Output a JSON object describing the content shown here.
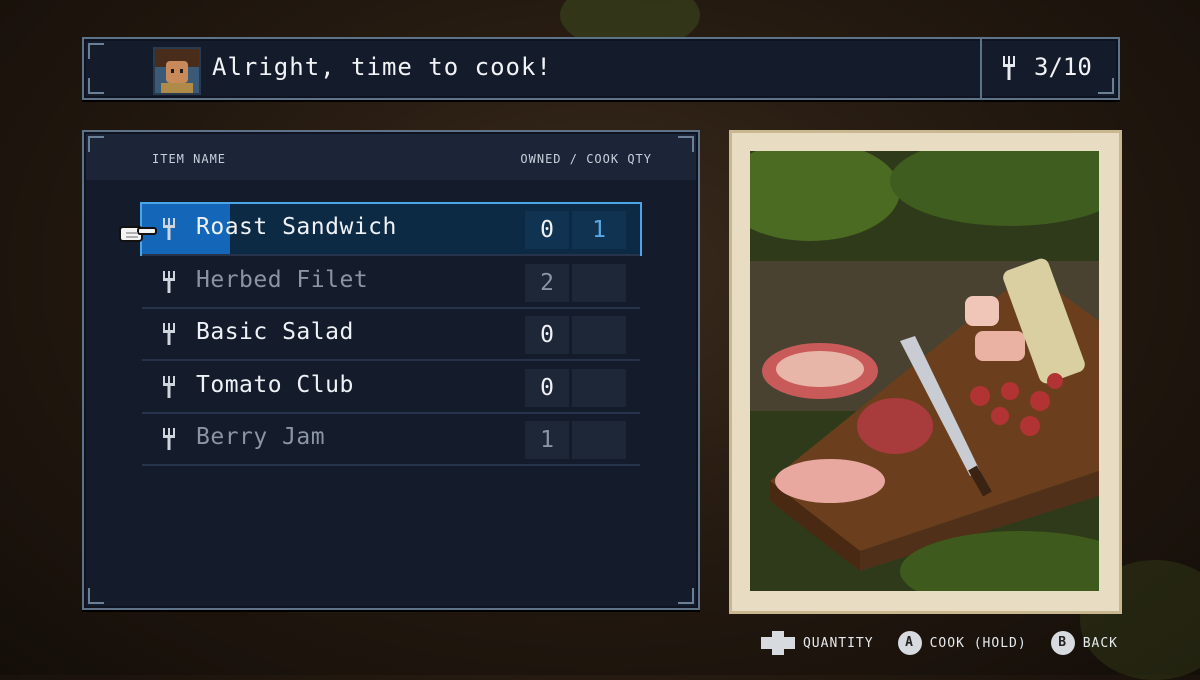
{
  "header": {
    "message": "Alright, time to cook!",
    "counter": "3/10",
    "counter_icon": "fork-icon",
    "avatar_icon": "character-portrait"
  },
  "list": {
    "col_name": "ITEM NAME",
    "col_qty": "OWNED / COOK QTY",
    "items": [
      {
        "name": "Roast Sandwich",
        "owned": "0",
        "qty": "1",
        "selected": true,
        "dim": false
      },
      {
        "name": "Herbed Filet",
        "owned": "2",
        "qty": "",
        "selected": false,
        "dim": true
      },
      {
        "name": "Basic Salad",
        "owned": "0",
        "qty": "",
        "selected": false,
        "dim": false
      },
      {
        "name": "Tomato Club",
        "owned": "0",
        "qty": "",
        "selected": false,
        "dim": false
      },
      {
        "name": "Berry Jam",
        "owned": "1",
        "qty": "",
        "selected": false,
        "dim": true
      }
    ]
  },
  "footer": {
    "quantity_label": "QUANTITY",
    "cook_button": "A",
    "cook_label": "COOK (HOLD)",
    "back_button": "B",
    "back_label": "BACK"
  },
  "colors": {
    "accent": "#4aa6e8",
    "panel": "#141c2b",
    "card": "#e8ddc2"
  }
}
